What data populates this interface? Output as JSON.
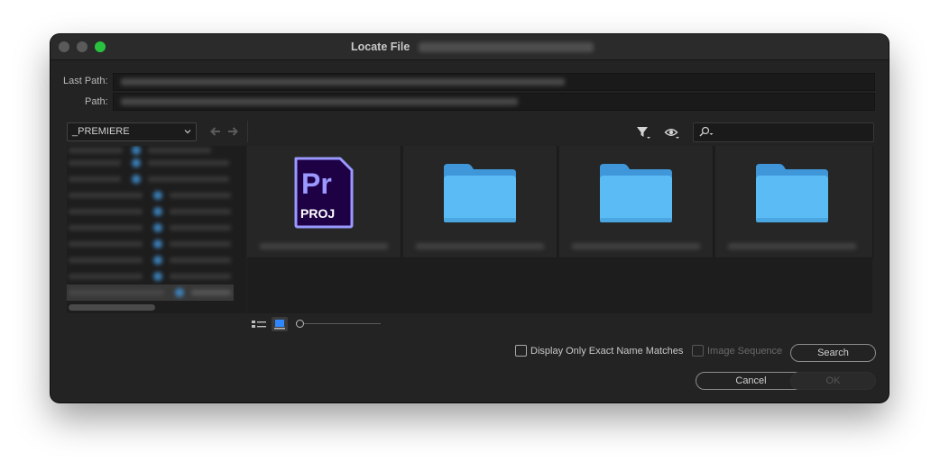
{
  "window": {
    "title": "Locate File"
  },
  "paths": {
    "last_path_label": "Last Path:",
    "path_label": "Path:"
  },
  "location": {
    "selected": "_PREMIERE"
  },
  "search": {
    "placeholder": ""
  },
  "files": [
    {
      "type": "premiere-project",
      "icon_text": "Pr",
      "icon_subtext": "PROJ",
      "icon": "premiere-project-icon"
    },
    {
      "type": "folder",
      "icon": "folder-icon"
    },
    {
      "type": "folder",
      "icon": "folder-icon"
    },
    {
      "type": "folder",
      "icon": "folder-icon"
    }
  ],
  "options": {
    "exact_match_label": "Display Only Exact Name Matches",
    "exact_match_checked": false,
    "image_sequence_label": "Image Sequence",
    "image_sequence_checked": false,
    "image_sequence_enabled": false
  },
  "buttons": {
    "search": "Search",
    "cancel": "Cancel",
    "ok": "OK"
  },
  "colors": {
    "premiere_accent": "#9999ff",
    "premiere_bg": "#1e0045",
    "folder": "#5bbcf5",
    "traffic_green": "#2ac13f"
  }
}
